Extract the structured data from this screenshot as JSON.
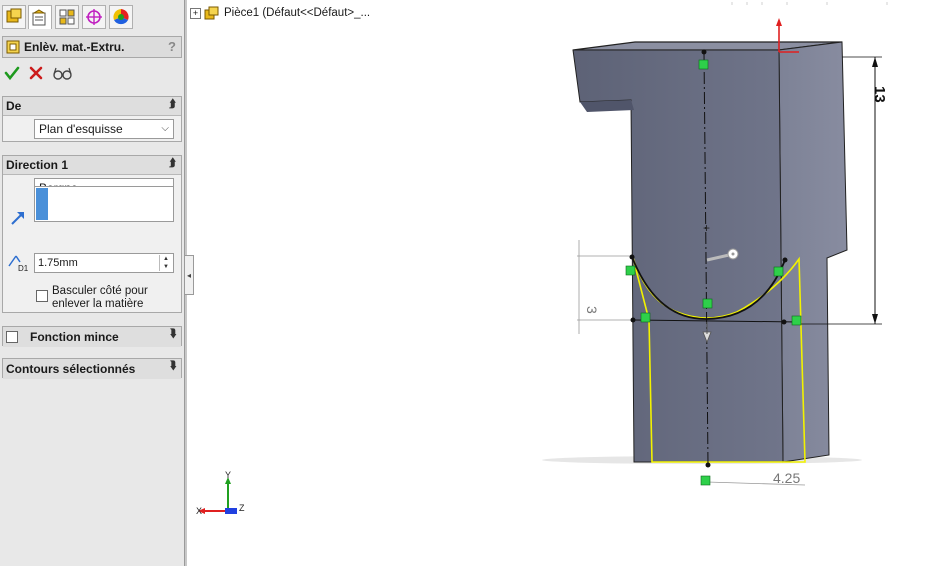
{
  "feature": {
    "title": "Enlèv. mat.-Extru.",
    "help_glyph": "?"
  },
  "tabs": [
    {
      "icon": "feature-manager-icon"
    },
    {
      "icon": "property-manager-icon"
    },
    {
      "icon": "configuration-manager-icon"
    },
    {
      "icon": "dimxpert-icon"
    },
    {
      "icon": "display-manager-icon"
    }
  ],
  "from_group": {
    "title": "De",
    "start_condition": "Plan d'esquisse"
  },
  "direction1": {
    "title": "Direction 1",
    "end_condition": "Borgne",
    "depth_value": "1.75mm",
    "depth_label": "D1",
    "flip_side_label_line1": "Basculer côté pour",
    "flip_side_label_line2": "enlever la matière"
  },
  "thin_feature": {
    "title": "Fonction mince"
  },
  "selected_contours": {
    "title": "Contours sélectionnés"
  },
  "tree": {
    "expand_glyph": "+",
    "item": "Pièce1  (Défaut<<Défaut>_..."
  },
  "dimensions": {
    "height": "13",
    "arc_height": "3",
    "width": "4.25"
  },
  "triad": {
    "x": "X",
    "y": "Y",
    "z": "Z"
  },
  "colors": {
    "model_face": "#6e7388",
    "model_face_dark": "#5f6478",
    "model_top": "#8a8ea0",
    "sketch_yellow": "#f2f200",
    "accent_blue": "#4a90d9",
    "ok_green": "#1e9a1e",
    "cancel_red": "#cc1b1b"
  }
}
